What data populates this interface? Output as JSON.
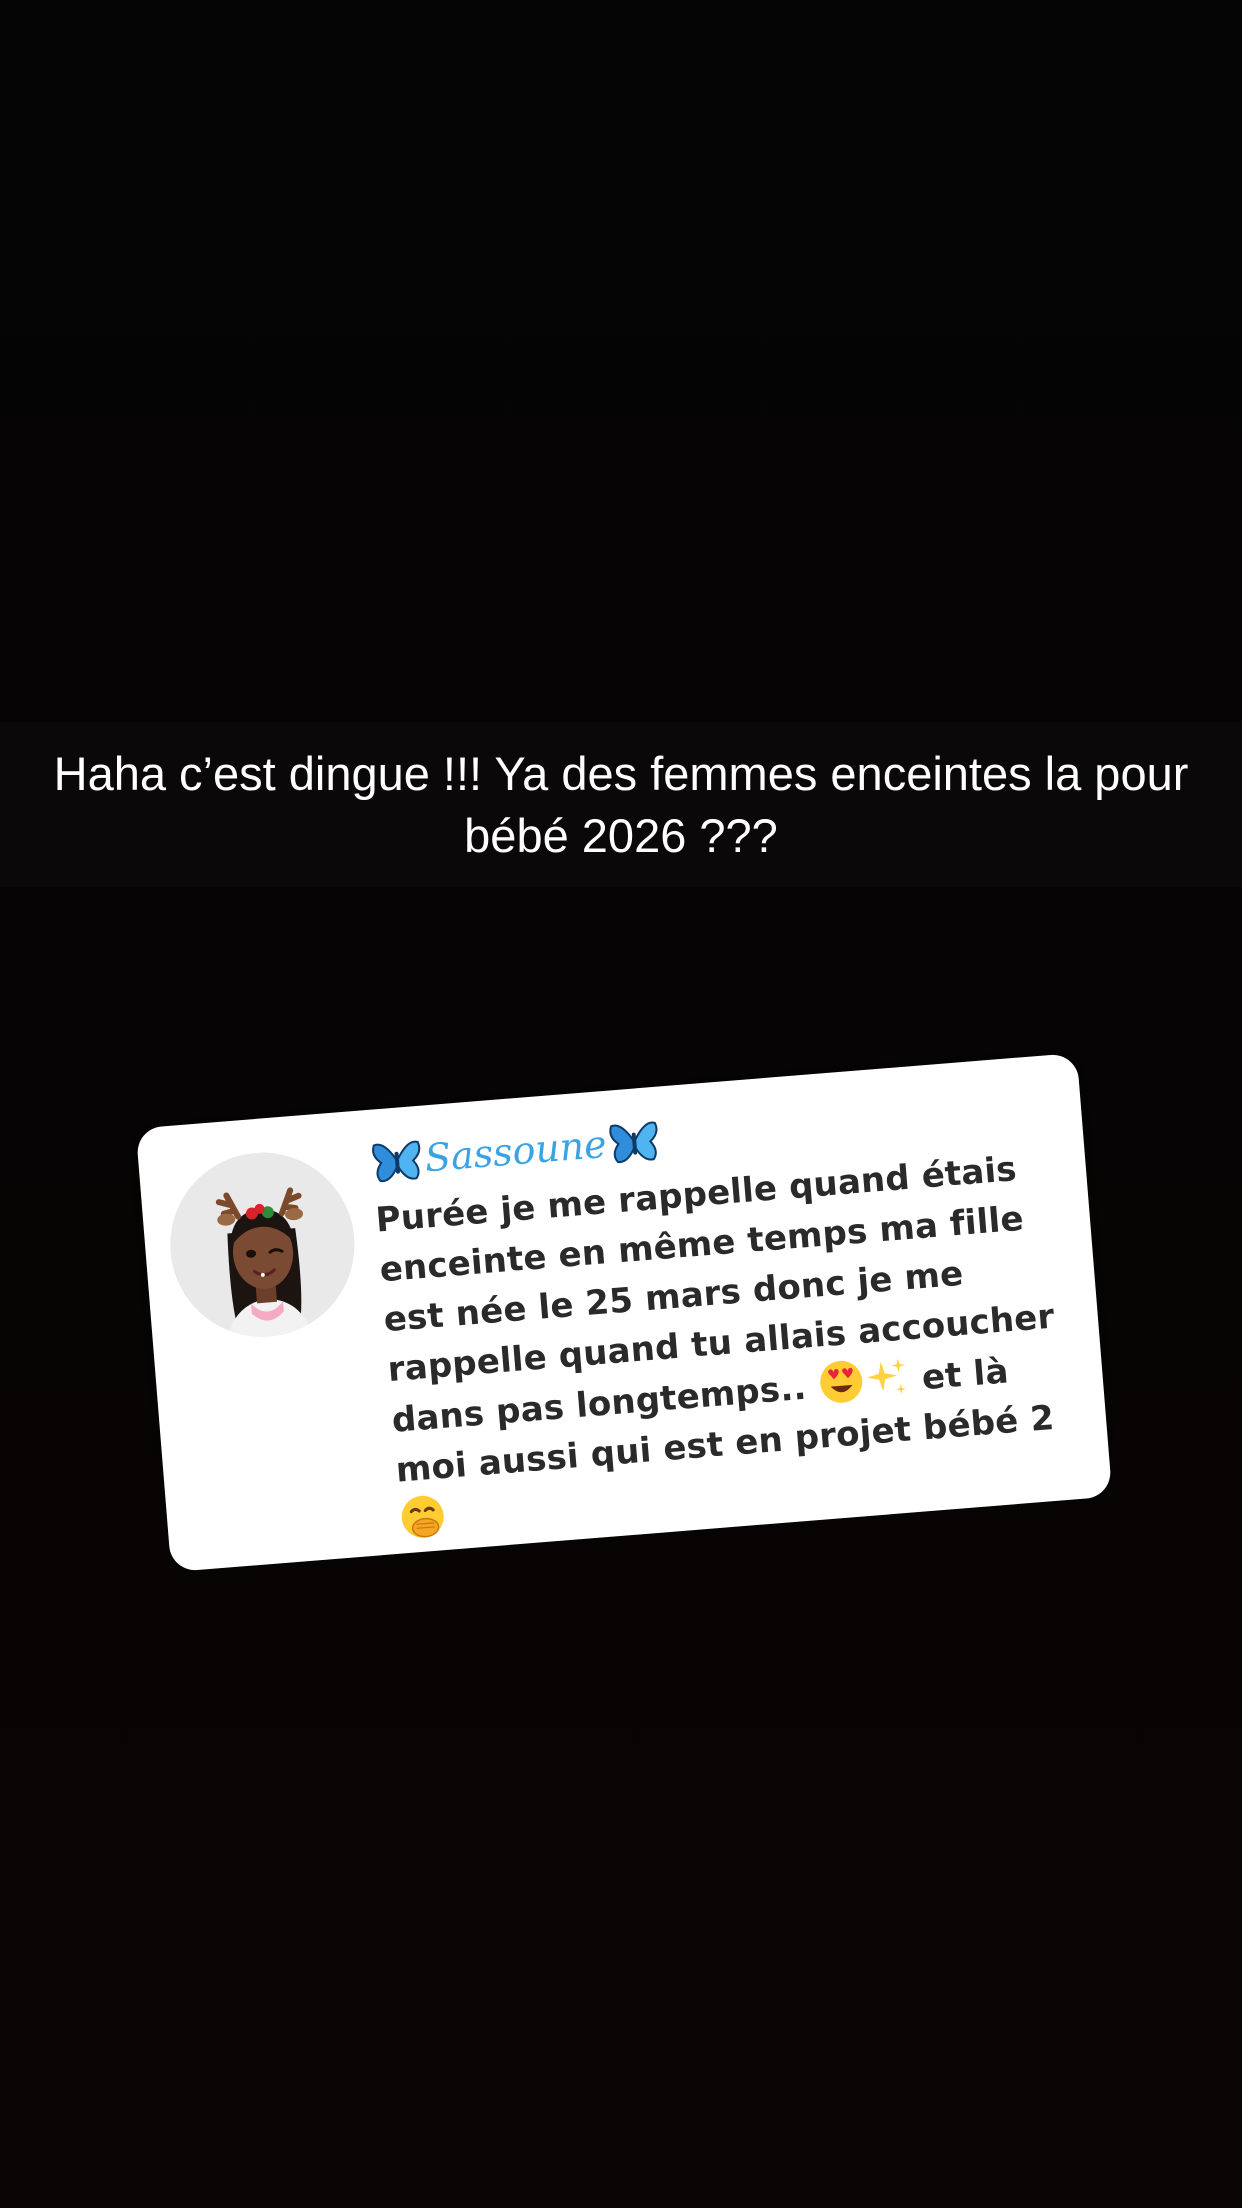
{
  "story": {
    "caption": "Haha c’est dingue !!! Ya des femmes enceintes la pour bébé 2026 ???"
  },
  "reply_card": {
    "author": {
      "name": "Sassoune",
      "decoration_icon": "blue-butterfly-emoji",
      "name_color": "#39a3e3"
    },
    "avatar": {
      "icon": "bitmoji-avatar-with-reindeer-antlers",
      "background": "#e9e9e9"
    },
    "message": {
      "part1": "Purée je me rappelle quand étais enceinte en même temps ma fille est née le 25 mars donc je me rappelle quand tu allais accoucher dans pas longtemps.. ",
      "part2": " et là moi aussi qui est en projet bébé 2 ",
      "emoji_1": "heart-eyes-emoji",
      "emoji_2": "sparkles-emoji",
      "emoji_3": "face-with-hand-over-mouth-emoji"
    }
  },
  "colors": {
    "background": "#000000",
    "card_background": "#ffffff",
    "caption_text": "#ffffff",
    "message_text": "#2a2a2a"
  }
}
